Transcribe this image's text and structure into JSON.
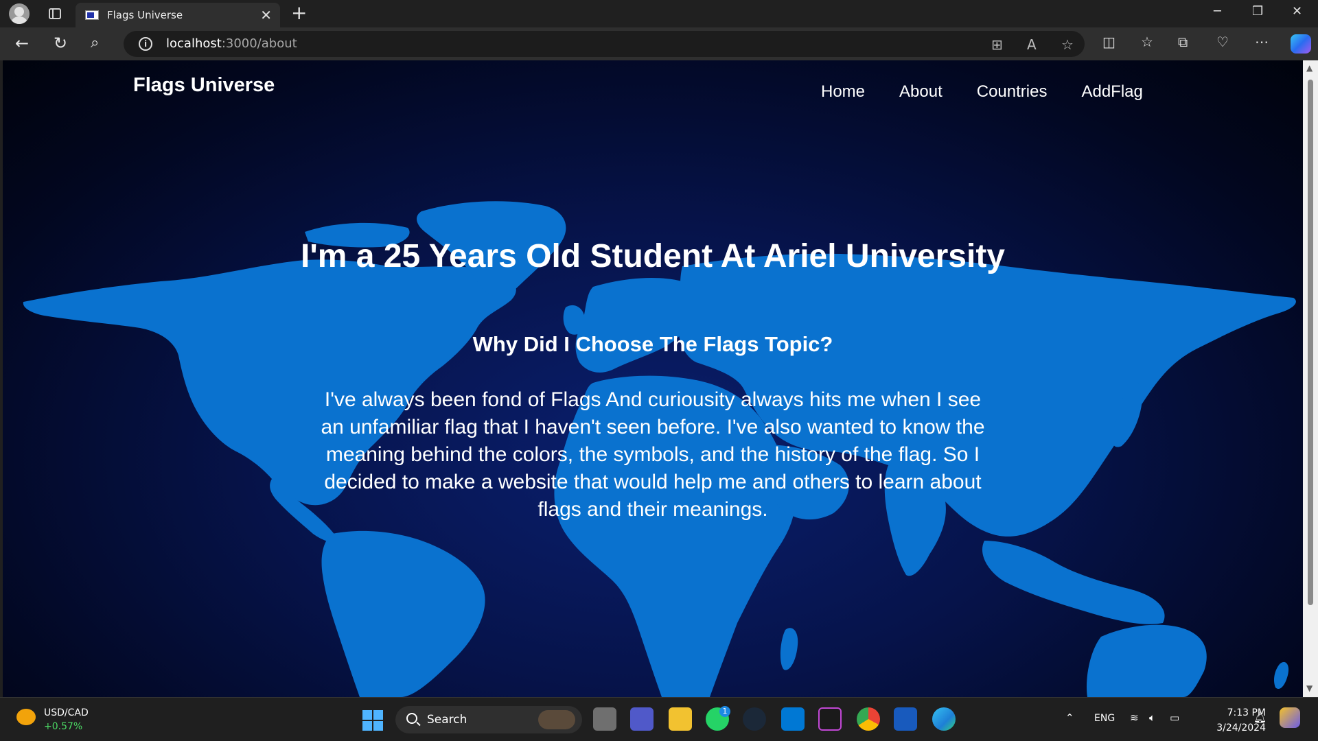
{
  "browser": {
    "tab_title": "Flags Universe",
    "url_host": "localhost",
    "url_path": ":3000/about"
  },
  "site": {
    "logo": "Flags Universe",
    "nav": [
      {
        "label": "Home"
      },
      {
        "label": "About"
      },
      {
        "label": "Countries"
      },
      {
        "label": "AddFlag"
      }
    ],
    "title": "I'm a 25 Years Old Student At Ariel University",
    "subtitle": "Why Did I Choose The Flags Topic?",
    "body": "I've always been fond of Flags And curiousity always hits me when I see an unfamiliar flag that I haven't seen before. I've also wanted to know the meaning behind the colors, the symbols, and the history of the flag. So I decided to make a website that would help me and others to learn about flags and their meanings."
  },
  "taskbar": {
    "ticker_name": "USD/CAD",
    "ticker_change": "+0.57%",
    "search_label": "Search",
    "language": "ENG",
    "time": "7:13 PM",
    "date": "3/24/2024",
    "whatsapp_badge": "1"
  },
  "colors": {
    "map_land": "#0a72cf",
    "page_bg_center": "#0a1f6e",
    "page_bg_edge": "#000208"
  }
}
